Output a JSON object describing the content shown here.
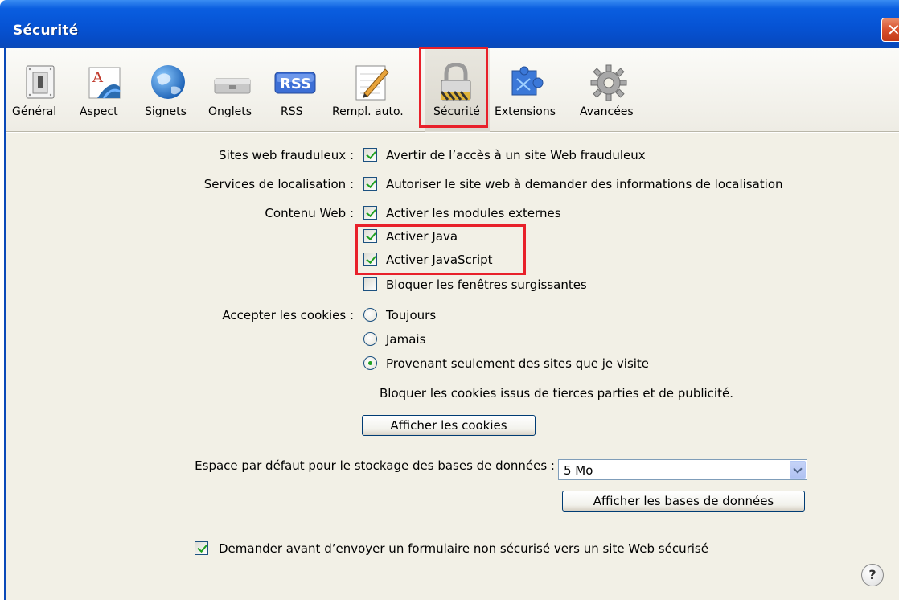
{
  "window": {
    "title": "Sécurité",
    "close_label": "✕"
  },
  "toolbar": {
    "items": [
      {
        "label": "Général",
        "icon": "general-switch-icon"
      },
      {
        "label": "Aspect",
        "icon": "aspect-font-icon"
      },
      {
        "label": "Signets",
        "icon": "globe-icon"
      },
      {
        "label": "Onglets",
        "icon": "tabs-icon"
      },
      {
        "label": "RSS",
        "icon": "rss-icon",
        "badge": "RSS"
      },
      {
        "label": "Rempl. auto.",
        "icon": "pencil-form-icon"
      },
      {
        "label": "Sécurité",
        "icon": "padlock-icon"
      },
      {
        "label": "Extensions",
        "icon": "extensions-puzzle-icon"
      },
      {
        "label": "Avancées",
        "icon": "gear-icon"
      }
    ],
    "selected": "Sécurité"
  },
  "security": {
    "fraud": {
      "label": "Sites web frauduleux :",
      "option": "Avertir de l’accès à un site Web frauduleux",
      "checked": true
    },
    "location": {
      "label": "Services de localisation :",
      "option": "Autoriser le site web à demander des informations de localisation",
      "checked": true
    },
    "web_content": {
      "label": "Contenu Web :",
      "plugins": {
        "text": "Activer les modules externes",
        "checked": true
      },
      "java": {
        "text": "Activer Java",
        "checked": true
      },
      "javascript": {
        "text": "Activer JavaScript",
        "checked": true
      },
      "popups": {
        "text": "Bloquer les fenêtres surgissantes",
        "checked": false
      }
    },
    "cookies": {
      "label": "Accepter les cookies :",
      "always": "Toujours",
      "never": "Jamais",
      "visited_only": "Provenant seulement des sites que je visite",
      "selected": "visited_only",
      "note": "Bloquer les cookies issus de tierces parties et de publicité.",
      "show_button": "Afficher les cookies"
    },
    "database": {
      "label": "Espace par défaut pour le stockage des bases de données :",
      "value": "5 Mo",
      "show_button": "Afficher les bases de données"
    },
    "insecure_form": {
      "text": "Demander avant d’envoyer un formulaire non sécurisé vers un site Web sécurisé",
      "checked": true
    },
    "help": "?"
  },
  "colors": {
    "titlebar": "#0653d4",
    "highlight": "#e8202a",
    "panel": "#f2f0e6",
    "check": "#21a121"
  }
}
